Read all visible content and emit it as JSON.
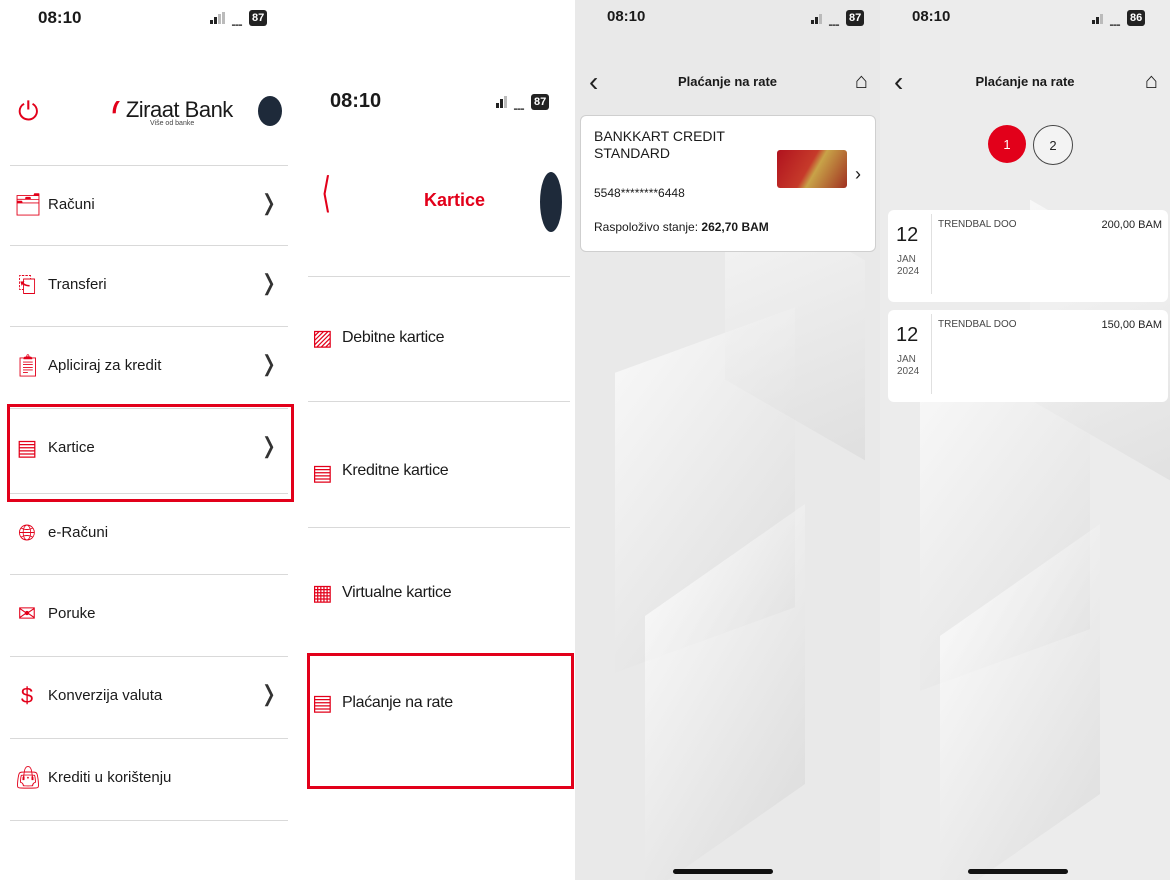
{
  "panel1": {
    "time": "08:10",
    "battery": "87",
    "logo_name": "Ziraat Bank",
    "logo_tagline": "Više od banke",
    "menu": [
      {
        "label": "Računi",
        "chevron": true
      },
      {
        "label": "Transferi",
        "chevron": true
      },
      {
        "label": "Apliciraj za kredit",
        "chevron": true
      },
      {
        "label": "Kartice",
        "chevron": true
      },
      {
        "label": "e-Računi",
        "chevron": false
      },
      {
        "label": "Poruke",
        "chevron": false
      },
      {
        "label": "Konverzija valuta",
        "chevron": true
      },
      {
        "label": "Krediti u korištenju",
        "chevron": false
      }
    ]
  },
  "panel2": {
    "time": "08:10",
    "battery": "87",
    "title": "Kartice",
    "items": [
      {
        "label": "Debitne kartice"
      },
      {
        "label": "Kreditne kartice"
      },
      {
        "label": "Virtualne kartice"
      },
      {
        "label": "Plaćanje na rate"
      }
    ]
  },
  "panel3": {
    "time": "08:10",
    "battery": "87",
    "title": "Plaćanje na rate",
    "card": {
      "name": "BANKKART CREDIT STANDARD",
      "number": "5548********6448",
      "balance_label": "Raspoloživo stanje:",
      "balance_value": "262,70 BAM"
    }
  },
  "panel4": {
    "time": "08:10",
    "battery": "86",
    "title": "Plaćanje na rate",
    "pages": [
      "1",
      "2"
    ],
    "transactions": [
      {
        "day": "12",
        "month": "JAN",
        "year": "2024",
        "merchant": "TRENDBAL DOO",
        "amount": "200,00 BAM"
      },
      {
        "day": "12",
        "month": "JAN",
        "year": "2024",
        "merchant": "TRENDBAL DOO",
        "amount": "150,00 BAM"
      }
    ]
  },
  "colors": {
    "accent": "#e2001a",
    "text": "#1a1a1a"
  },
  "icons": {
    "power": "power-icon",
    "chevron": "chevron-right-icon",
    "back": "chevron-left-icon",
    "home": "home-icon",
    "wifi": "wifi-icon",
    "signal": "signal-icon"
  }
}
